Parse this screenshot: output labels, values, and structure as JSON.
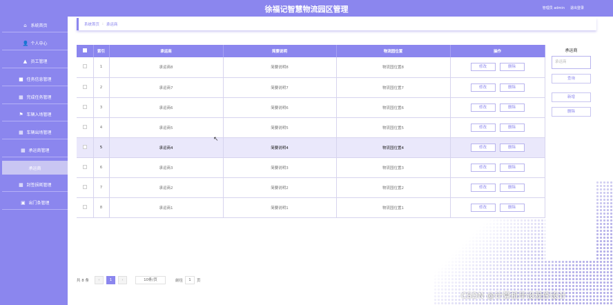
{
  "header": {
    "title": "徐福记智慧物流园区管理",
    "user": "管理员 admin",
    "logout": "退出登录"
  },
  "sidebar": {
    "items": [
      {
        "label": "系统首页",
        "icon": "home-icon",
        "glyph": "⌂"
      },
      {
        "label": "个人中心",
        "icon": "user-icon",
        "glyph": "👤"
      },
      {
        "label": "员工管理",
        "icon": "staff-icon",
        "glyph": "▲"
      },
      {
        "label": "任务信息管理",
        "icon": "task-icon",
        "glyph": "■"
      },
      {
        "label": "完成任务管理",
        "icon": "grid-icon",
        "glyph": "▦"
      },
      {
        "label": "车辆入场管理",
        "icon": "flag-icon",
        "glyph": "⚑"
      },
      {
        "label": "车辆出场管理",
        "icon": "grid-icon",
        "glyph": "▦"
      },
      {
        "label": "承运商管理",
        "icon": "grid-icon",
        "glyph": "▦"
      },
      {
        "label": "承运商",
        "icon": "",
        "glyph": ""
      },
      {
        "label": "封签损耗管理",
        "icon": "grid-icon",
        "glyph": "▦"
      },
      {
        "label": "出门条管理",
        "icon": "door-icon",
        "glyph": "▣"
      }
    ]
  },
  "breadcrumb": {
    "home": "系统首页",
    "sep": ":",
    "current": "承运商"
  },
  "table": {
    "headers": [
      "",
      "索引",
      "承运商",
      "简要说明",
      "物流园位置",
      "操作"
    ],
    "rows": [
      {
        "idx": "1",
        "carrier": "承运商8",
        "desc": "简要说明8",
        "loc": "物流园位置8"
      },
      {
        "idx": "2",
        "carrier": "承运商7",
        "desc": "简要说明7",
        "loc": "物流园位置7"
      },
      {
        "idx": "3",
        "carrier": "承运商6",
        "desc": "简要说明6",
        "loc": "物流园位置6"
      },
      {
        "idx": "4",
        "carrier": "承运商5",
        "desc": "简要说明5",
        "loc": "物流园位置5"
      },
      {
        "idx": "5",
        "carrier": "承运商4",
        "desc": "简要说明4",
        "loc": "物流园位置4"
      },
      {
        "idx": "6",
        "carrier": "承运商3",
        "desc": "简要说明3",
        "loc": "物流园位置3"
      },
      {
        "idx": "7",
        "carrier": "承运商2",
        "desc": "简要说明2",
        "loc": "物流园位置2"
      },
      {
        "idx": "8",
        "carrier": "承运商1",
        "desc": "简要说明1",
        "loc": "物流园位置1"
      }
    ],
    "edit_label": "修改",
    "delete_label": "删除"
  },
  "search": {
    "label": "承运商",
    "placeholder": "承运商",
    "query_btn": "查询",
    "add_btn": "新增",
    "delete_btn": "删除"
  },
  "pager": {
    "total": "共 8 条",
    "prev": "‹",
    "page": "1",
    "next": "›",
    "size": "10条/页",
    "goto": "前往",
    "goto_value": "1",
    "page_unit": "页"
  },
  "watermark": "CSDN @计算机毕设程序设计",
  "colors": {
    "accent": "#8b86ee",
    "highlight_row": "#eae8fb"
  }
}
